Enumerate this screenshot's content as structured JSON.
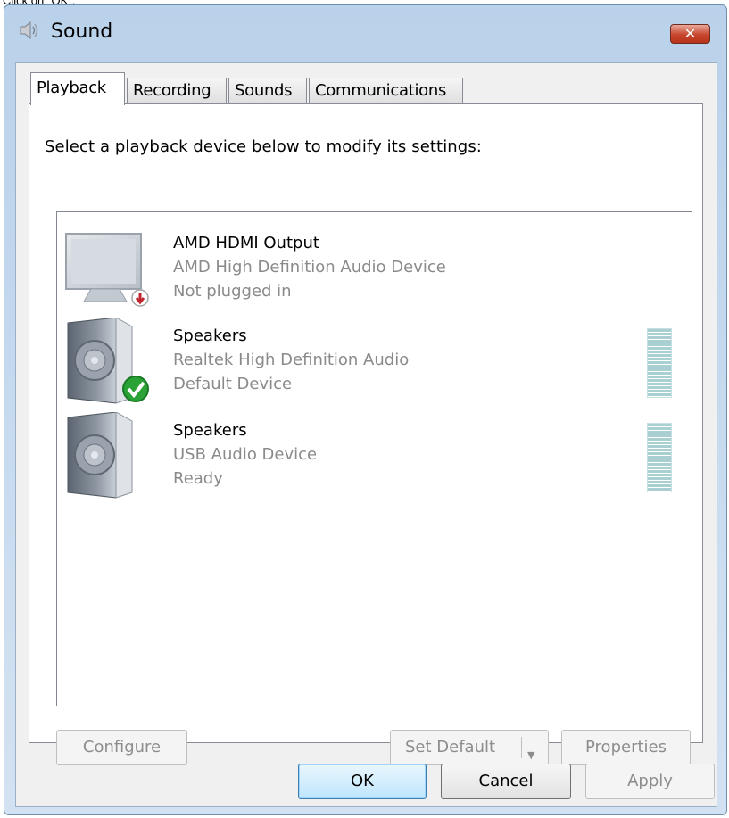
{
  "instruction": "Click on \"OK\".",
  "window": {
    "title": "Sound",
    "icon": "speaker-icon",
    "close_label": "✕"
  },
  "tabs": [
    {
      "label": "Playback",
      "active": true
    },
    {
      "label": "Recording",
      "active": false
    },
    {
      "label": "Sounds",
      "active": false
    },
    {
      "label": "Communications",
      "active": false
    }
  ],
  "panel": {
    "heading": "Select a playback device below to modify its settings:"
  },
  "devices": [
    {
      "name": "AMD HDMI Output",
      "description": "AMD High Definition Audio Device",
      "status": "Not plugged in",
      "icon": "monitor-icon",
      "badge": "unplugged-badge-icon",
      "level_meter": false
    },
    {
      "name": "Speakers",
      "description": "Realtek High Definition Audio",
      "status": "Default Device",
      "icon": "speaker-device-icon",
      "badge": "default-checkmark-icon",
      "level_meter": true
    },
    {
      "name": "Speakers",
      "description": "USB Audio Device",
      "status": "Ready",
      "icon": "speaker-device-icon",
      "badge": "",
      "level_meter": true
    }
  ],
  "buttons": {
    "configure": "Configure",
    "set_default": "Set Default",
    "properties": "Properties",
    "ok": "OK",
    "cancel": "Cancel",
    "apply": "Apply"
  },
  "colors": {
    "window_frame": "#b9d1ea",
    "close_button": "#c7462d",
    "disabled_text": "#8d8d8d",
    "secondary_text": "#8a8a8a",
    "level_meter": "#a9cfd2"
  }
}
